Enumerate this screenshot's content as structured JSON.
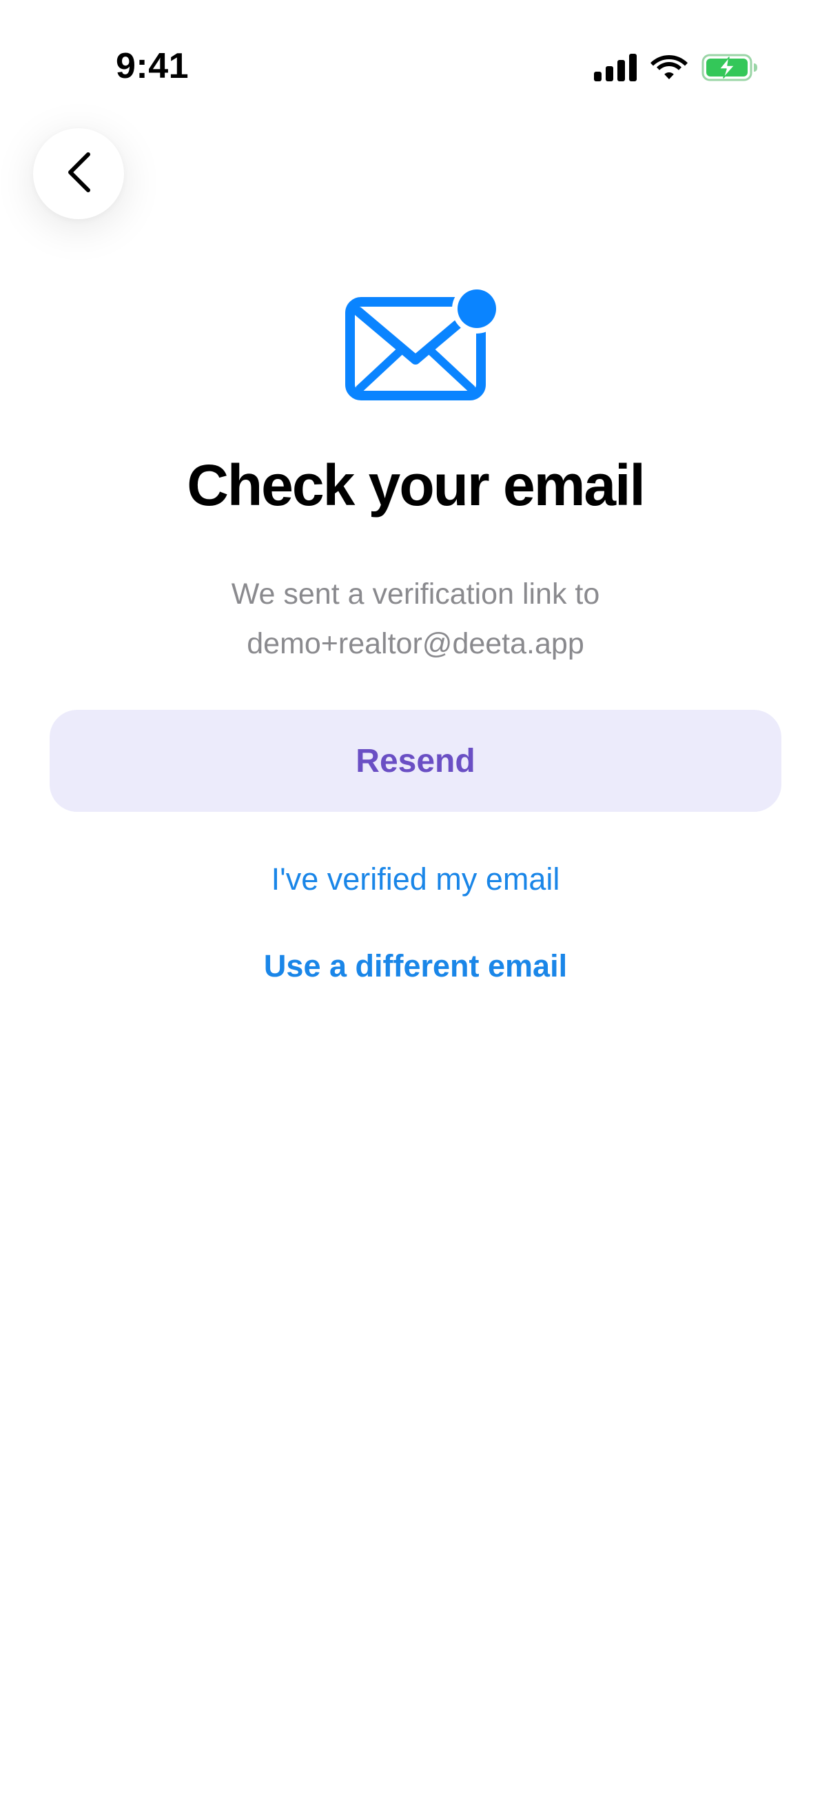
{
  "status_bar": {
    "time": "9:41",
    "icons": [
      "cellular-signal-icon",
      "wifi-icon",
      "battery-charging-icon"
    ],
    "battery_color": "#34c759"
  },
  "back_button": {
    "icon": "chevron-left-icon"
  },
  "hero": {
    "icon": "mail-notification-icon",
    "accent_color": "#0a84ff"
  },
  "title": "Check your email",
  "subtitle": {
    "line1": "We sent a verification link to",
    "email": "demo+realtor@deeta.app"
  },
  "resend_button": {
    "label": "Resend",
    "background": "#ecebfb",
    "text_color": "#6a4fc4"
  },
  "links": {
    "verified": "I've verified my email",
    "different_email": "Use a different email",
    "color": "#1a86e8"
  }
}
